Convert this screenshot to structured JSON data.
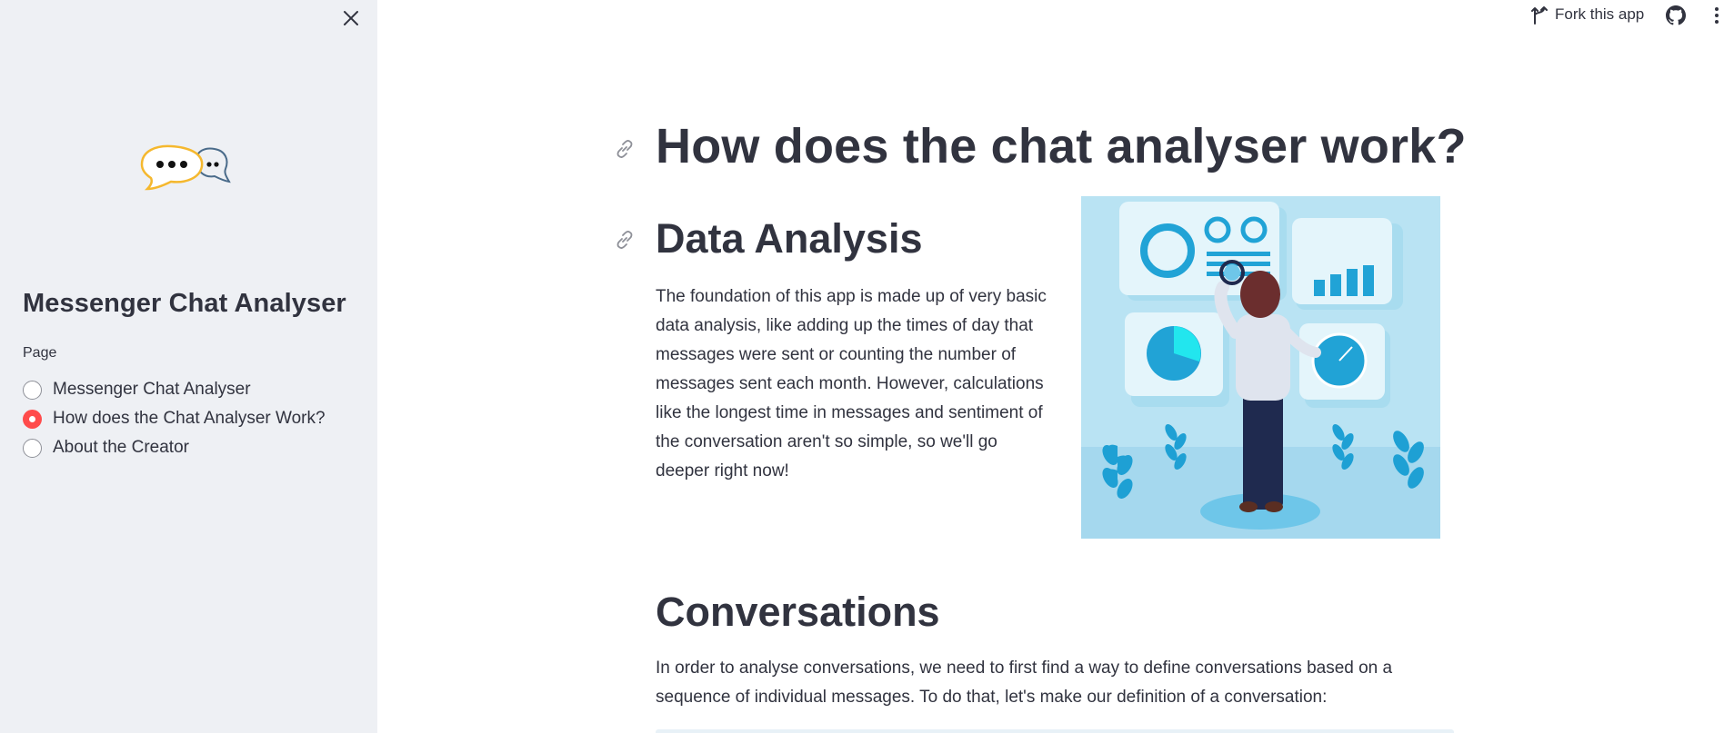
{
  "sidebar": {
    "app_title": "Messenger Chat Analyser",
    "radio_label": "Page",
    "items": [
      {
        "label": "Messenger Chat Analyser",
        "selected": false
      },
      {
        "label": "How does the Chat Analyser Work?",
        "selected": true
      },
      {
        "label": "About the Creator",
        "selected": false
      }
    ],
    "accent_color": "#ff4b4b",
    "close_icon": "close-icon",
    "logo": "chat-bubbles-logo"
  },
  "header": {
    "fork_label": "Fork this app",
    "fork_icon": "fork-icon",
    "github_icon": "github-icon",
    "menu_icon": "more-vertical-icon"
  },
  "main": {
    "title": "How does the chat analyser work?",
    "sections": [
      {
        "heading": "Data Analysis",
        "body": "The foundation of this app is made up of very basic data analysis, like adding up the times of day that messages were sent or counting the number of messages sent each month. However, calculations like the longest time in messages and sentiment of the conversation aren't so simple, so we'll go deeper right now!"
      },
      {
        "heading": "Conversations",
        "body": "In order to analyse conversations, we need to first find a way to define conversations based on a sequence of individual messages. To do that, let's make our definition of a conversation:"
      }
    ],
    "link_icon": "link-icon",
    "illustration": "data-analysis-illustration"
  }
}
